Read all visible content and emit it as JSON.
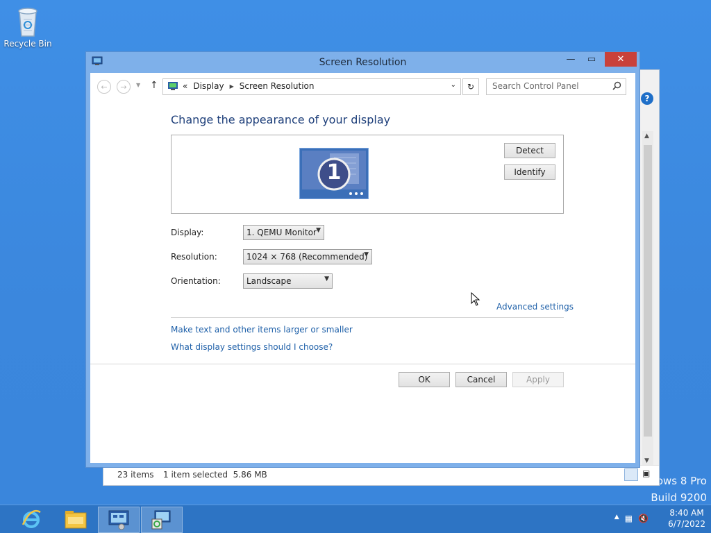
{
  "desktop": {
    "recycle_bin_label": "Recycle Bin",
    "watermark_line1": "dows 8 Pro",
    "watermark_line2": "Build 9200"
  },
  "background_window": {
    "status_items": "23 items",
    "status_selection": "1 item selected  5.86 MB"
  },
  "window": {
    "title": "Screen Resolution",
    "breadcrumb_prefix": "«",
    "breadcrumb": [
      "Display",
      "Screen Resolution"
    ],
    "search_placeholder": "Search Control Panel",
    "heading": "Change the appearance of your display",
    "monitor_number": "1",
    "detect_label": "Detect",
    "identify_label": "Identify",
    "display_label": "Display:",
    "display_value": "1. QEMU Monitor",
    "resolution_label": "Resolution:",
    "resolution_value": "1024 × 768 (Recommended)",
    "orientation_label": "Orientation:",
    "orientation_value": "Landscape",
    "advanced_link": "Advanced settings",
    "link_text_size": "Make text and other items larger or smaller",
    "link_choose": "What display settings should I choose?",
    "ok_label": "OK",
    "cancel_label": "Cancel",
    "apply_label": "Apply"
  },
  "taskbar": {
    "time": "8:40 AM",
    "date": "6/7/2022",
    "apps": [
      "internet-explorer-icon",
      "file-explorer-icon",
      "control-panel-icon",
      "display-settings-icon"
    ]
  },
  "colors": {
    "desktop_bg": "#3b87dd",
    "titlebar": "#7eb0ea",
    "close_button": "#c9413a",
    "link": "#1d5fa8",
    "heading": "#1e3f7a",
    "taskbar": "#2d74c4"
  }
}
